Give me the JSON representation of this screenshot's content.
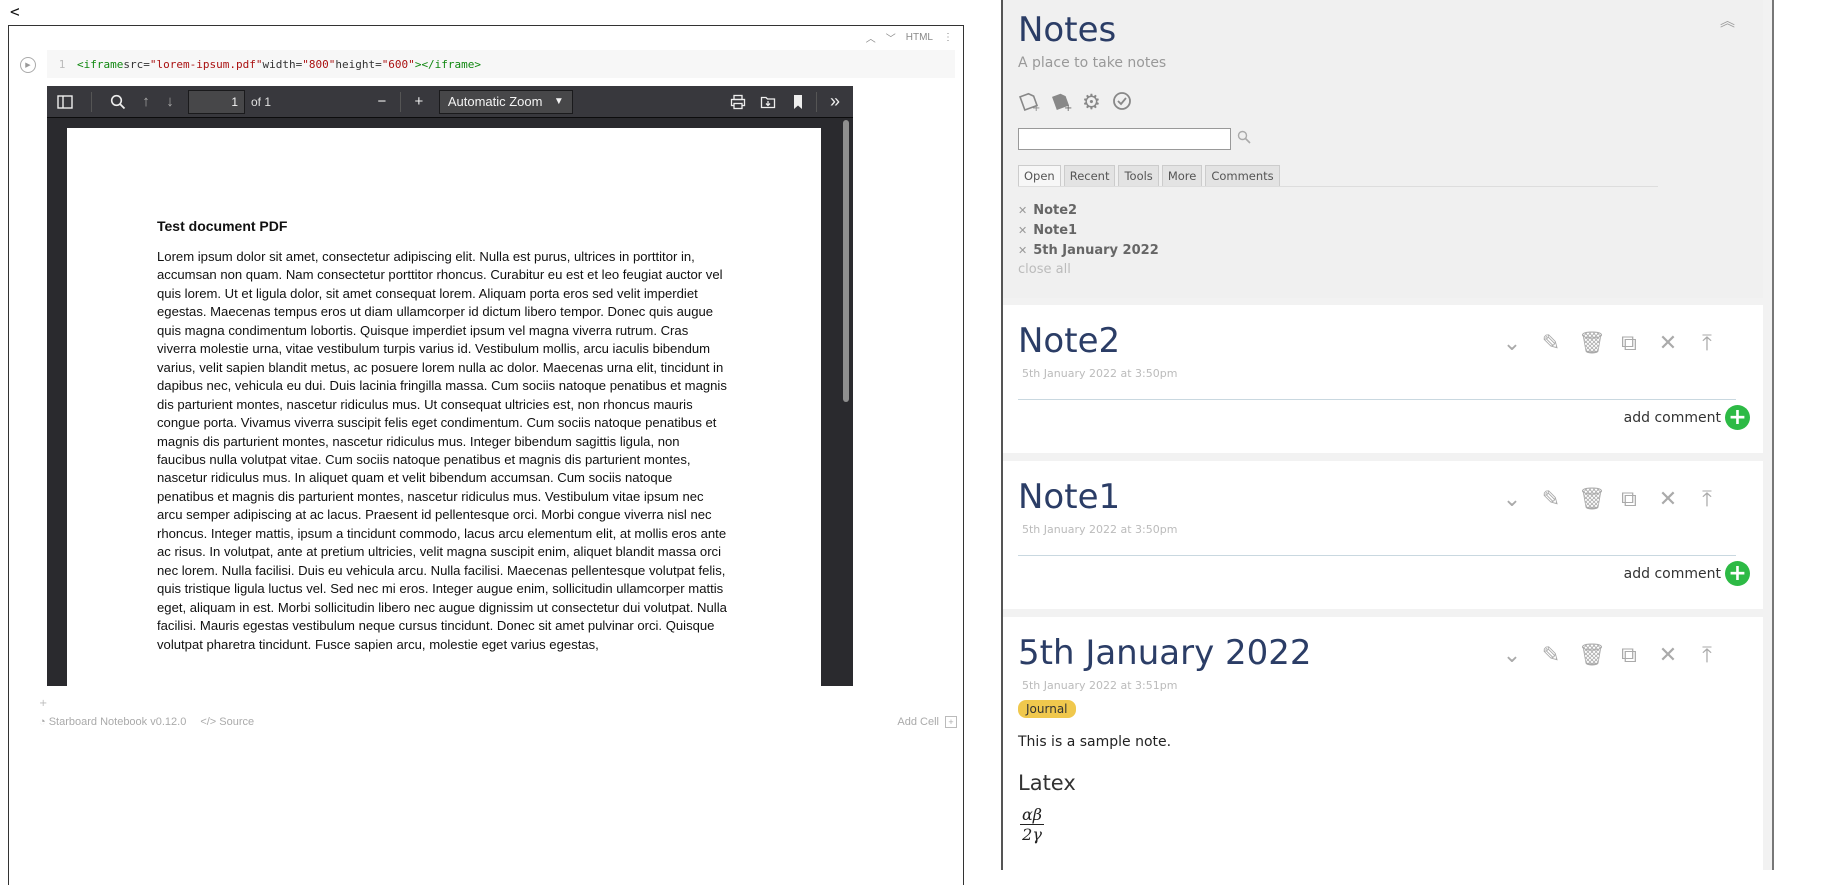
{
  "back_arrow": "<",
  "cell_toolbar": {
    "up": "^",
    "down": "v",
    "lang": "HTML",
    "more": "⋮"
  },
  "code": {
    "line_number": "1",
    "tokens": {
      "open": "<iframe",
      "src_attr": " src=",
      "src_val": "\"lorem-ipsum.pdf\"",
      "width_attr": " width=",
      "width_val": "\"800\"",
      "height_attr": " height=",
      "height_val": "\"600\"",
      "gt": ">",
      "close": "</iframe",
      "close_gt": ">"
    }
  },
  "pdf": {
    "page_number": "1",
    "page_of": "of 1",
    "zoom": "Automatic Zoom",
    "title": "Test document PDF",
    "body": "Lorem ipsum dolor sit amet, consectetur adipiscing elit. Nulla est purus, ultrices in porttitor in, accumsan non quam. Nam consectetur porttitor rhoncus. Curabitur eu est et leo feugiat auctor vel quis lorem. Ut et ligula dolor, sit amet consequat lorem. Aliquam porta eros sed velit imperdiet egestas. Maecenas tempus eros ut diam ullamcorper id dictum libero tempor. Donec quis augue quis magna condimentum lobortis. Quisque imperdiet ipsum vel magna viverra rutrum. Cras viverra molestie urna, vitae vestibulum turpis varius id. Vestibulum mollis, arcu iaculis bibendum varius, velit sapien blandit metus, ac posuere lorem nulla ac dolor. Maecenas urna elit, tincidunt in dapibus nec, vehicula eu dui. Duis lacinia fringilla massa. Cum sociis natoque penatibus et magnis dis parturient montes, nascetur ridiculus mus. Ut consequat ultricies est, non rhoncus mauris congue porta. Vivamus viverra suscipit felis eget condimentum. Cum sociis natoque penatibus et magnis dis parturient montes, nascetur ridiculus mus. Integer bibendum sagittis ligula, non faucibus nulla volutpat vitae. Cum sociis natoque penatibus et magnis dis parturient montes, nascetur ridiculus mus. In aliquet quam et velit bibendum accumsan. Cum sociis natoque penatibus et magnis dis parturient montes, nascetur ridiculus mus. Vestibulum vitae ipsum nec arcu semper adipiscing at ac lacus. Praesent id pellentesque orci. Morbi congue viverra nisl nec rhoncus. Integer mattis, ipsum a tincidunt commodo, lacus arcu elementum elit, at mollis eros ante ac risus. In volutpat, ante at pretium ultricies, velit magna suscipit enim, aliquet blandit massa orci nec lorem. Nulla facilisi. Duis eu vehicula arcu. Nulla facilisi. Maecenas pellentesque volutpat felis, quis tristique ligula luctus vel. Sed nec mi eros. Integer augue enim, sollicitudin ullamcorper mattis eget, aliquam in est. Morbi sollicitudin libero nec augue dignissim ut consectetur dui volutpat. Nulla facilisi. Mauris egestas vestibulum neque cursus tincidunt. Donec sit amet pulvinar orci. Quisque volutpat pharetra tincidunt. Fusce sapien arcu, molestie eget varius egestas,"
  },
  "footer": {
    "add_cell_marker": "+",
    "brand": "Starboard Notebook v0.12.0",
    "source": "Source",
    "add_cell": "Add Cell"
  },
  "sidebar": {
    "title": "Notes",
    "subtitle": "A place to take notes",
    "tabs": [
      "Open",
      "Recent",
      "Tools",
      "More",
      "Comments"
    ],
    "open_notes": [
      "Note2",
      "Note1",
      "5th January 2022"
    ],
    "close_all": "close all"
  },
  "notes": [
    {
      "title": "Note2",
      "date": "5th January 2022 at 3:50pm",
      "add_comment": "add comment"
    },
    {
      "title": "Note1",
      "date": "5th January 2022 at 3:50pm",
      "add_comment": "add comment"
    },
    {
      "title": "5th January 2022",
      "date": "5th January 2022 at 3:51pm",
      "tag": "Journal",
      "text": "This is a sample note.",
      "heading": "Latex",
      "math_num": "αβ",
      "math_den": "2γ"
    }
  ],
  "colors": {
    "accent": "#2b3d66",
    "plus": "#2dba45",
    "badge": "#f0c84d",
    "pdf_toolbar": "#38383d"
  }
}
